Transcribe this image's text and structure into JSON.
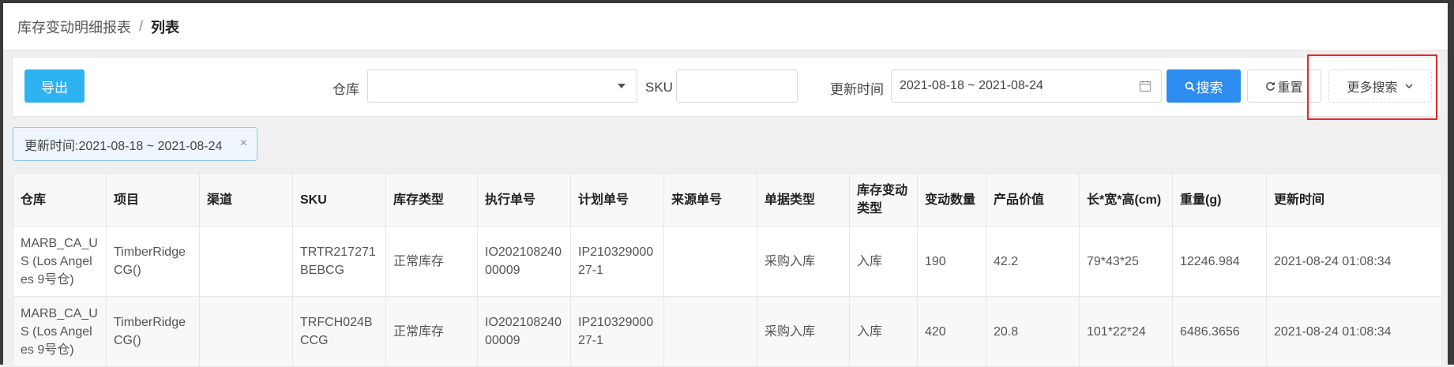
{
  "breadcrumb": {
    "parent": "库存变动明细报表",
    "separator": "/",
    "current": "列表"
  },
  "toolbar": {
    "export_label": "导出",
    "warehouse_label": "仓库",
    "warehouse_value": "",
    "sku_label": "SKU",
    "sku_value": "",
    "update_time_label": "更新时间",
    "update_time_value": "2021-08-18 ~ 2021-08-24",
    "search_label": "搜索",
    "reset_label": "重置",
    "more_search_label": "更多搜索"
  },
  "active_filter": {
    "text": "更新时间:2021-08-18 ~ 2021-08-24",
    "close": "×"
  },
  "table": {
    "columns": [
      "仓库",
      "项目",
      "渠道",
      "SKU",
      "库存类型",
      "执行单号",
      "计划单号",
      "来源单号",
      "单据类型",
      "库存变动类型",
      "变动数量",
      "产品价值",
      "长*宽*高(cm)",
      "重量(g)",
      "更新时间"
    ],
    "rows": [
      [
        "MARB_CA_US (Los Angeles 9号仓)",
        "TimberRidgeCG()",
        "",
        "TRTR217271BEBCG",
        "正常库存",
        "IO20210824000009",
        "IP21032900027-1",
        "",
        "采购入库",
        "入库",
        "190",
        "42.2",
        "79*43*25",
        "12246.984",
        "2021-08-24 01:08:34"
      ],
      [
        "MARB_CA_US (Los Angeles 9号仓)",
        "TimberRidgeCG()",
        "",
        "TRFCH024BCCG",
        "正常库存",
        "IO20210824000009",
        "IP21032900027-1",
        "",
        "采购入库",
        "入库",
        "420",
        "20.8",
        "101*22*24",
        "6486.3656",
        "2021-08-24 01:08:34"
      ]
    ]
  }
}
